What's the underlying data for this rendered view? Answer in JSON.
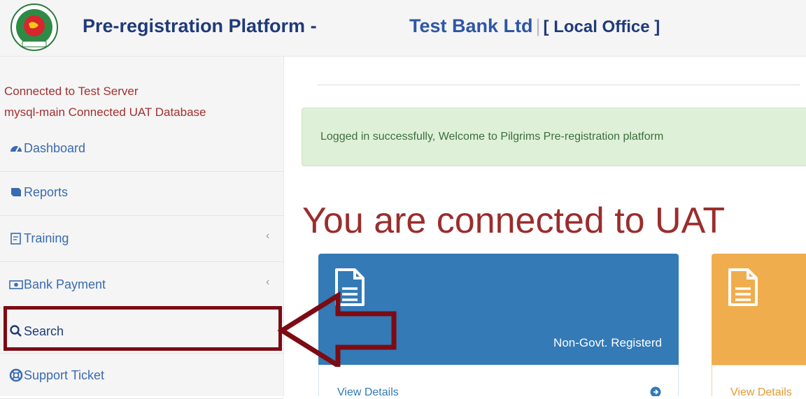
{
  "header": {
    "title": "Pre-registration Platform -",
    "bank_name": "Test Bank Ltd",
    "divider": "|",
    "office": "[ Local Office ]"
  },
  "sidebar": {
    "status_server": "Connected to Test Server",
    "status_db": "mysql-main Connected UAT Database",
    "items": [
      {
        "label": "Dashboard",
        "icon": "dashboard-icon"
      },
      {
        "label": "Reports",
        "icon": "book-icon"
      },
      {
        "label": "Training",
        "icon": "training-icon",
        "chevron": "‹"
      },
      {
        "label": "Bank Payment",
        "icon": "money-icon",
        "chevron": "‹"
      },
      {
        "label": "Search",
        "icon": "search-icon"
      },
      {
        "label": "Support Ticket",
        "icon": "lifebuoy-icon"
      }
    ]
  },
  "main": {
    "alert_text": "Logged in successfully, Welcome to Pilgrims Pre-registration platform",
    "big_text": "You are connected to UAT",
    "cards": [
      {
        "label": "Non-Govt. Registerd",
        "footer": "View Details",
        "color": "#337ab7"
      },
      {
        "label": "",
        "footer": "View Details",
        "color": "#f0ad4e"
      }
    ]
  },
  "colors": {
    "header_title": "#1f3a7a",
    "bank_name": "#2d56a8",
    "sidebar_status": "#a33030",
    "sidebar_link": "#3a6bb0",
    "alert_bg": "#dff0d8",
    "big_text": "#9b2d2d",
    "highlight": "#7d0b13"
  }
}
